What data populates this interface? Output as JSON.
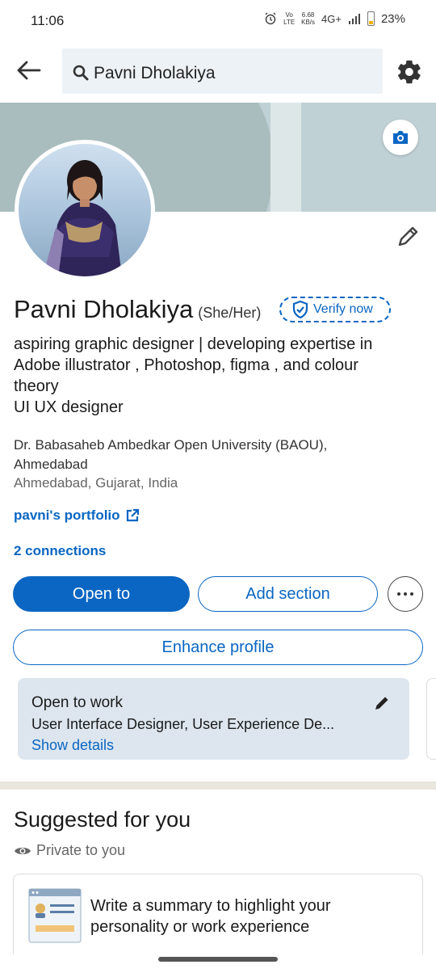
{
  "status_bar": {
    "time": "11:06",
    "volte": "Vo LTE",
    "speed": "6.68",
    "speed_unit": "KB/s",
    "network": "4G+",
    "battery": "23%"
  },
  "search": {
    "query": "Pavni Dholakiya"
  },
  "profile": {
    "name": "Pavni Dholakiya",
    "pronouns": "(She/Her)",
    "verify_label": "Verify now",
    "headline_lines": [
      "aspiring graphic designer | developing expertise in",
      "Adobe illustrator , Photoshop, figma , and colour",
      "theory",
      "UI UX designer"
    ],
    "education_lines": [
      "Dr. Babasaheb Ambedkar Open University (BAOU),",
      "Ahmedabad"
    ],
    "location": "Ahmedabad, Gujarat, India",
    "portfolio_label": "pavni's portfolio",
    "connections": "2 connections"
  },
  "actions": {
    "open_to": "Open to",
    "add_section": "Add section",
    "enhance_profile": "Enhance profile"
  },
  "open_to_work": {
    "title": "Open to work",
    "roles": "User Interface Designer, User Experience De...",
    "show_details": "Show details"
  },
  "suggested": {
    "title": "Suggested for you",
    "privacy": "Private to you",
    "card_lines": [
      "Write a summary to highlight your",
      "personality or work experience"
    ]
  },
  "colors": {
    "accent": "#0a66c2",
    "banner": "#c0d1d6",
    "card_bg": "#dde6ee"
  }
}
